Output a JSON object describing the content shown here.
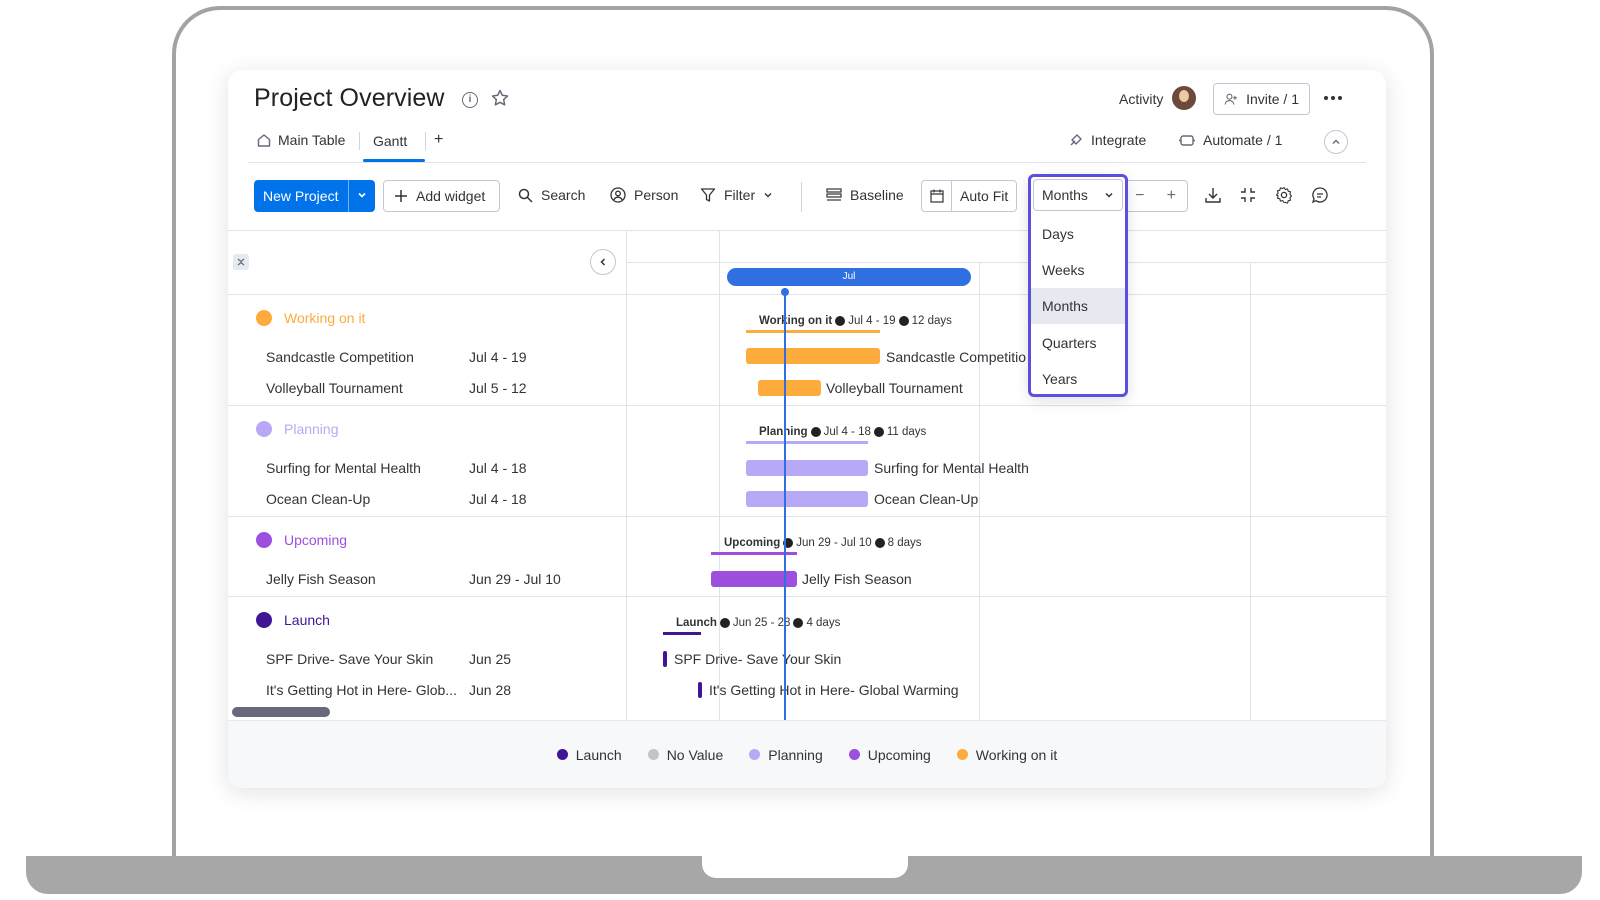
{
  "header": {
    "title": "Project Overview",
    "activity_label": "Activity",
    "invite_label": "Invite / 1"
  },
  "tabs": [
    {
      "label": "Main Table"
    },
    {
      "label": "Gantt",
      "active": true
    },
    {
      "label": "+"
    }
  ],
  "top_actions": {
    "integrate_label": "Integrate",
    "automate_label": "Automate / 1"
  },
  "toolbar": {
    "new_project_label": "New Project",
    "add_widget_label": "Add widget",
    "search_label": "Search",
    "person_label": "Person",
    "filter_label": "Filter",
    "baseline_label": "Baseline",
    "auto_fit_label": "Auto Fit",
    "zoom_out": "−",
    "zoom_in": "+"
  },
  "timescale": {
    "selected": "Months",
    "options": [
      "Days",
      "Weeks",
      "Months",
      "Quarters",
      "Years"
    ]
  },
  "timeline": {
    "month_label": "Jul"
  },
  "groups": [
    {
      "name": "Working on it",
      "color": "#fdab3d",
      "summary": {
        "name": "Working on it",
        "range": "Jul 4 - 19",
        "duration": "12 days"
      },
      "items": [
        {
          "name": "Sandcastle Competition",
          "dates": "Jul 4 - 19",
          "bar_label": "Sandcastle Competitio"
        },
        {
          "name": "Volleyball Tournament",
          "dates": "Jul 5 - 12",
          "bar_label": "Volleyball Tournament"
        }
      ]
    },
    {
      "name": "Planning",
      "color": "#b9a8f5",
      "summary": {
        "name": "Planning",
        "range": "Jul 4 - 18",
        "duration": "11 days"
      },
      "items": [
        {
          "name": "Surfing for Mental Health",
          "dates": "Jul 4 - 18",
          "bar_label": "Surfing for Mental Health"
        },
        {
          "name": "Ocean Clean-Up",
          "dates": "Jul 4 - 18",
          "bar_label": "Ocean Clean-Up"
        }
      ]
    },
    {
      "name": "Upcoming",
      "color": "#9d50dd",
      "summary": {
        "name": "Upcoming",
        "range": "Jun 29 - Jul 10",
        "duration": "8 days"
      },
      "items": [
        {
          "name": "Jelly Fish Season",
          "dates": "Jun 29 - Jul 10",
          "bar_label": "Jelly Fish Season"
        }
      ]
    },
    {
      "name": "Launch",
      "color": "#401694",
      "summary": {
        "name": "Launch",
        "range": "Jun 25 - 28",
        "duration": "4 days"
      },
      "items": [
        {
          "name": "SPF Drive- Save Your Skin",
          "dates": "Jun 25",
          "bar_label": "SPF Drive- Save Your Skin"
        },
        {
          "name": "It's Getting Hot in Here- Glob...",
          "dates": "Jun 28",
          "bar_label": "It's Getting Hot in Here- Global Warming"
        }
      ]
    }
  ],
  "legend": [
    {
      "label": "Launch",
      "color": "#401694"
    },
    {
      "label": "No Value",
      "color": "#c4c4c4"
    },
    {
      "label": "Planning",
      "color": "#b9a8f5"
    },
    {
      "label": "Upcoming",
      "color": "#9d50dd"
    },
    {
      "label": "Working on it",
      "color": "#fdab3d"
    }
  ],
  "colors": {
    "accent": "#0073ea",
    "dropdown_highlight": "#5b4fe0",
    "today_line": "#2f6fe0"
  }
}
